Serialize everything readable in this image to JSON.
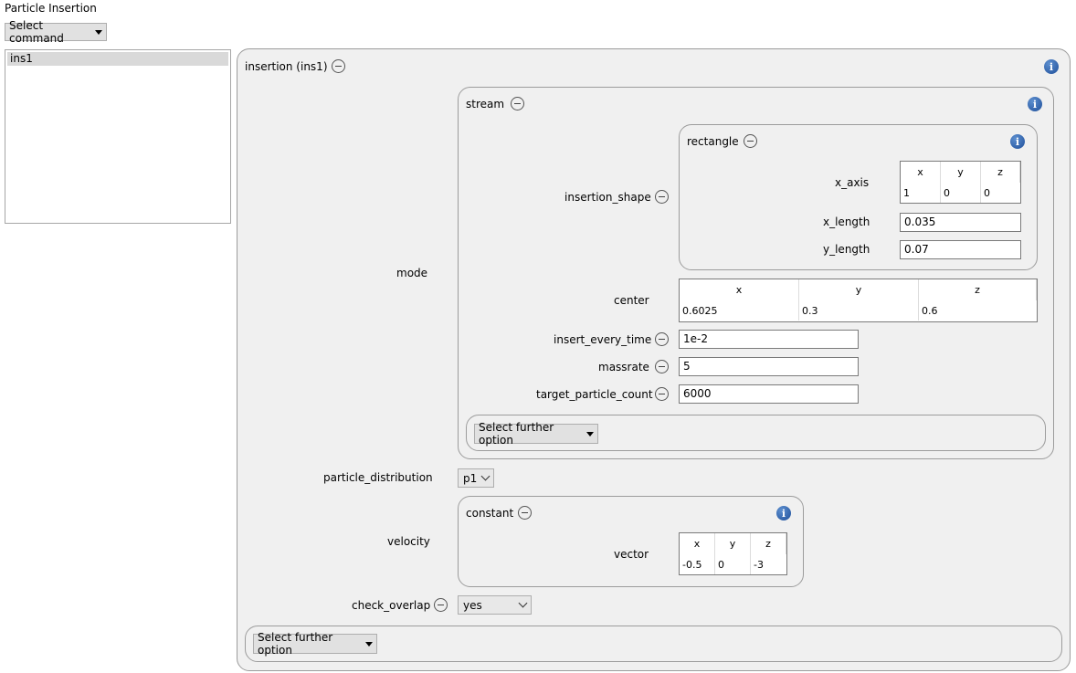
{
  "window_title": "Particle Insertion",
  "select_command_label": "Select command",
  "command_list": [
    "ins1"
  ],
  "insertion": {
    "title": "insertion (ins1)",
    "mode_label": "mode",
    "stream": {
      "title": "stream",
      "insertion_shape_label": "insertion_shape",
      "rectangle": {
        "title": "rectangle",
        "x_axis_label": "x_axis",
        "x_axis_headers": [
          "x",
          "y",
          "z"
        ],
        "x_axis_values": [
          "1",
          "0",
          "0"
        ],
        "x_length_label": "x_length",
        "x_length_value": "0.035",
        "y_length_label": "y_length",
        "y_length_value": "0.07"
      },
      "center_label": "center",
      "center_headers": [
        "x",
        "y",
        "z"
      ],
      "center_values": [
        "0.6025",
        "0.3",
        "0.6"
      ],
      "insert_every_time_label": "insert_every_time",
      "insert_every_time_value": "1e-2",
      "massrate_label": "massrate",
      "massrate_value": "5",
      "target_particle_count_label": "target_particle_count",
      "target_particle_count_value": "6000",
      "further_option_label": "Select further option"
    },
    "particle_distribution_label": "particle_distribution",
    "particle_distribution_value": "p1",
    "velocity_label": "velocity",
    "constant": {
      "title": "constant",
      "vector_label": "vector",
      "vector_headers": [
        "x",
        "y",
        "z"
      ],
      "vector_values": [
        "-0.5",
        "0",
        "-3"
      ]
    },
    "check_overlap_label": "check_overlap",
    "check_overlap_value": "yes",
    "further_option_label": "Select further option"
  },
  "info_glyph": "i"
}
